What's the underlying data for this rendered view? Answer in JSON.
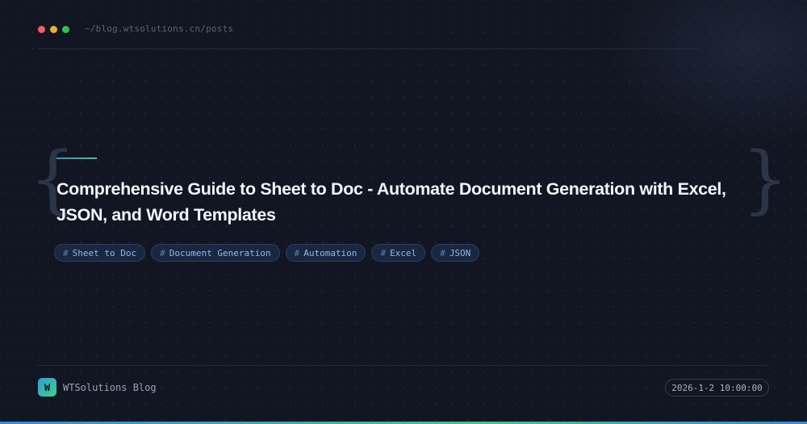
{
  "window": {
    "path": "~/blog.wtsolutions.cn/posts"
  },
  "post": {
    "title": "Comprehensive Guide to Sheet to Doc - Automate Document Generation with Excel, JSON, and Word Templates",
    "brace_open": "{",
    "brace_close": "}",
    "tags": [
      {
        "hash": "#",
        "label": "Sheet to Doc"
      },
      {
        "hash": "#",
        "label": "Document Generation"
      },
      {
        "hash": "#",
        "label": "Automation"
      },
      {
        "hash": "#",
        "label": "Excel"
      },
      {
        "hash": "#",
        "label": "JSON"
      }
    ]
  },
  "footer": {
    "logo_letter": "W",
    "brand": "WTSolutions Blog",
    "date": "2026-1-2 10:00:00"
  },
  "colors": {
    "background": "#121622",
    "accent_start": "#2a8fd6",
    "accent_end": "#3cc68a",
    "tag_text": "#8fb9ea"
  }
}
